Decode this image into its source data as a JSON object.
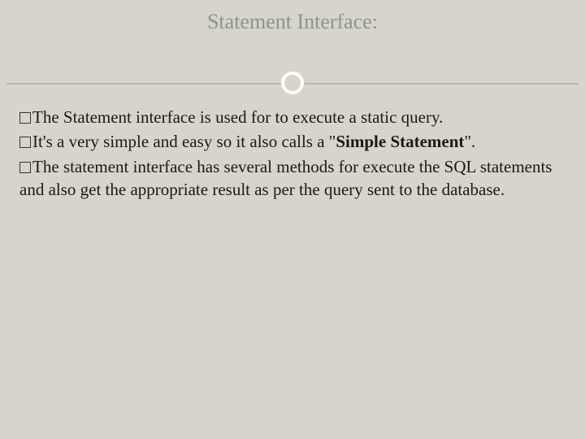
{
  "slide": {
    "title": "Statement Interface:",
    "bullets": [
      {
        "text_before": "The Statement interface is used for to execute a static query.",
        "bold_text": "",
        "text_after": ""
      },
      {
        "text_before": "It's a very simple and easy so it also calls a \"",
        "bold_text": "Simple Statement",
        "text_after": "\"."
      },
      {
        "text_before": "The statement interface has several methods for execute the SQL statements and also get the appropriate result as per the query sent to the database.",
        "bold_text": "",
        "text_after": ""
      }
    ]
  }
}
